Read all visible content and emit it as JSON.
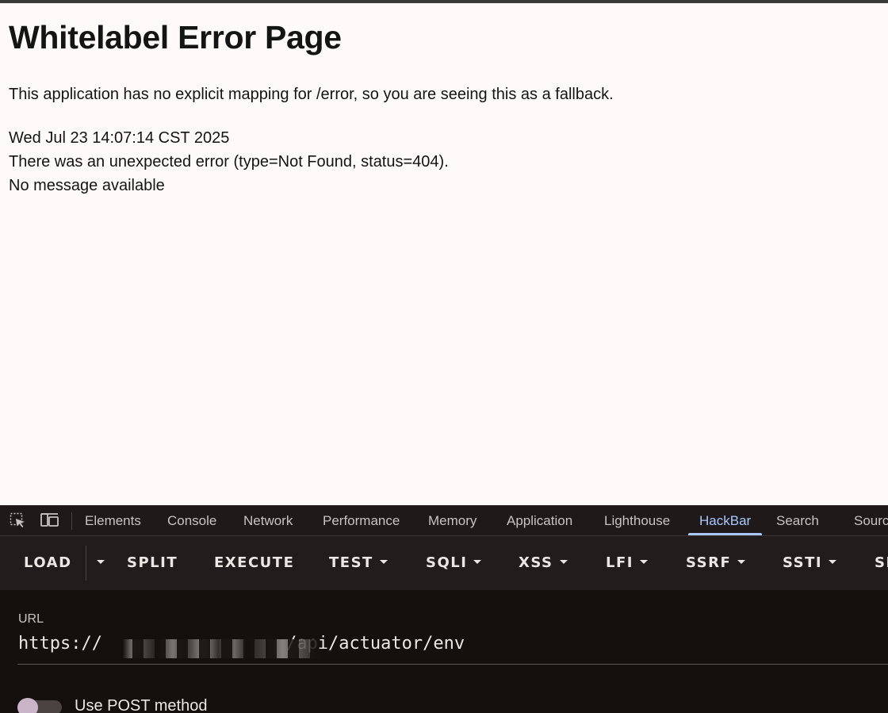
{
  "error_page": {
    "title": "Whitelabel Error Page",
    "description": "This application has no explicit mapping for /error, so you are seeing this as a fallback.",
    "timestamp": "Wed Jul 23 14:07:14 CST 2025",
    "error_line": "There was an unexpected error (type=Not Found, status=404).",
    "message": "No message available"
  },
  "devtools": {
    "icons": [
      "inspect-element-icon",
      "device-toolbar-icon"
    ],
    "tabs": [
      "Elements",
      "Console",
      "Network",
      "Performance",
      "Memory",
      "Application",
      "Lighthouse",
      "HackBar",
      "Search",
      "Sourc"
    ],
    "active_tab": "HackBar",
    "accent_color": "#a9c7ff"
  },
  "hackbar": {
    "toolbar": {
      "load": "LOAD",
      "split": "SPLIT",
      "execute": "EXECUTE",
      "test": "TEST",
      "sqli": "SQLI",
      "xss": "XSS",
      "lfi": "LFI",
      "ssrf": "SSRF",
      "ssti": "SSTI",
      "overflow": "SI"
    },
    "url_label": "URL",
    "url_prefix": "https://",
    "url_suffix": "/api/actuator/env",
    "post_label": "Use POST method",
    "post_enabled": false
  }
}
